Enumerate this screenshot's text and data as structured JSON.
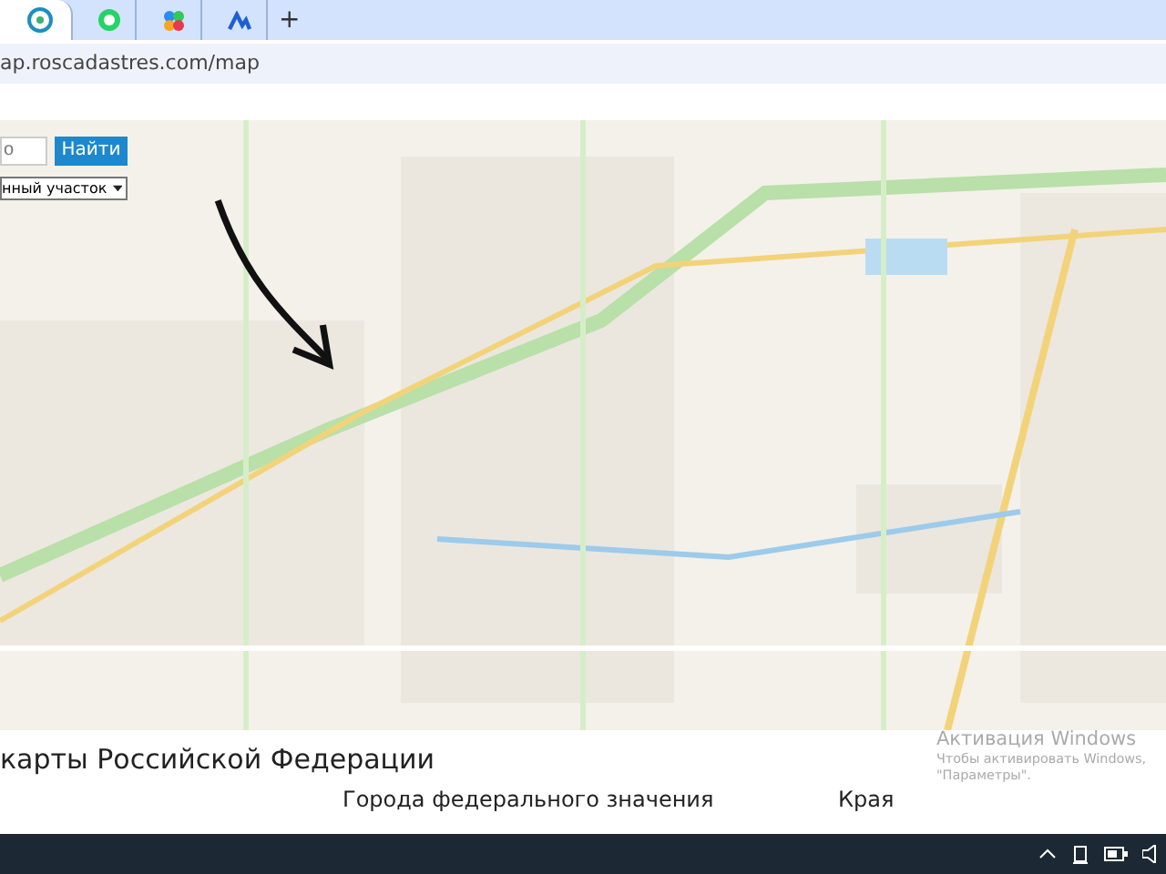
{
  "browser": {
    "tabs": [
      {
        "selected": true
      },
      {
        "selected": false
      },
      {
        "selected": false
      },
      {
        "selected": false
      }
    ],
    "new_tab": "+",
    "address": "ap.roscadastres.com/map"
  },
  "map": {
    "search": {
      "placeholder": "о",
      "button": "Найти"
    },
    "select": "нный участок"
  },
  "section": {
    "heading": "карты Российской Федерации",
    "columns": [
      "Города федерального значения",
      "Края"
    ]
  },
  "activation": {
    "title": "Активация Windows",
    "lines": [
      "Чтобы активировать Windows,",
      "\"Параметры\"."
    ]
  }
}
